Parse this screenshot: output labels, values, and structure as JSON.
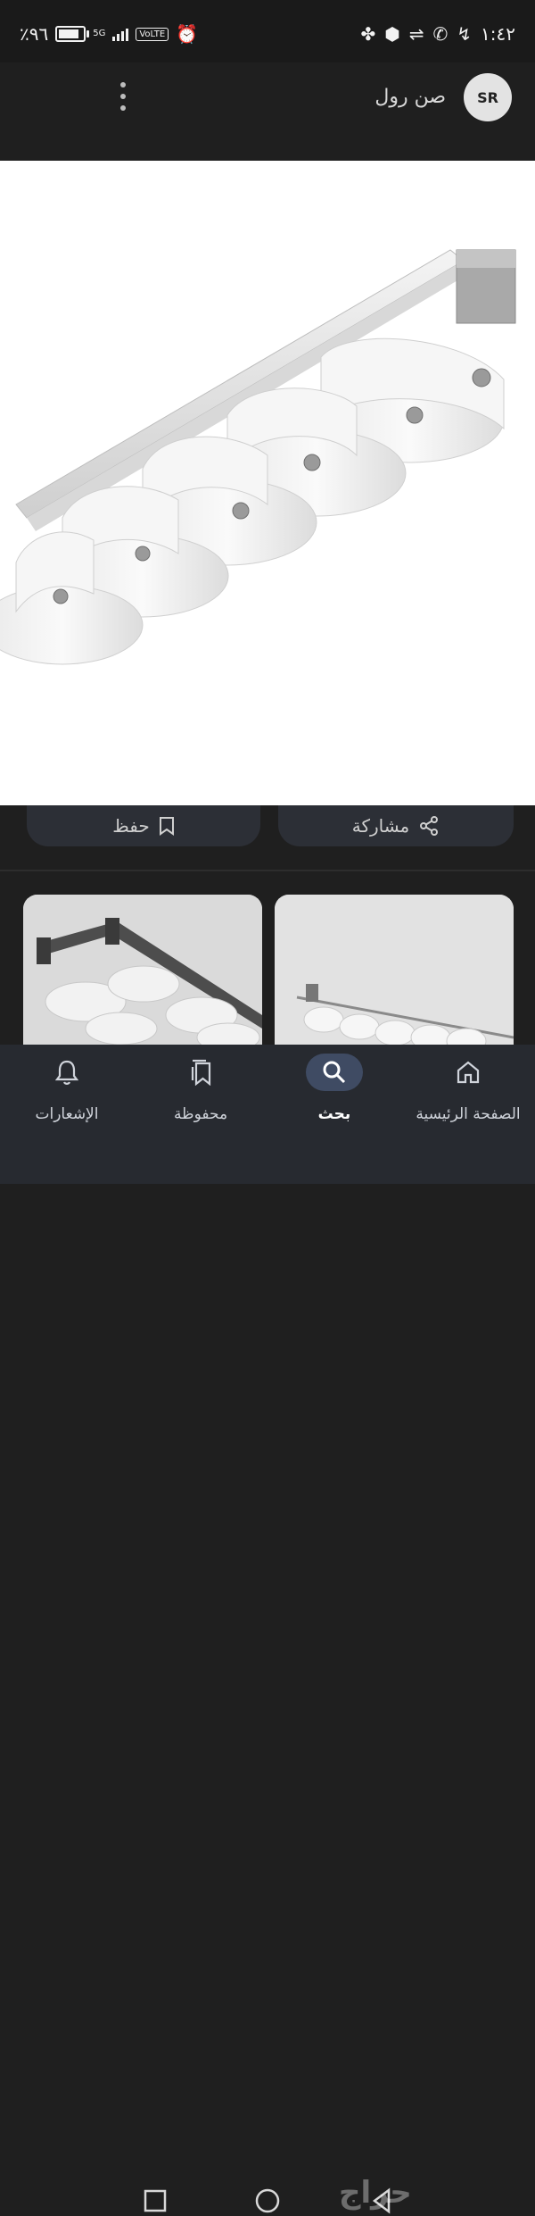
{
  "status_bar": {
    "battery": "٪٩٦",
    "battery_level": 0.96,
    "network": "5G",
    "volte": "VoLTE",
    "time": "١:٤٢"
  },
  "app_bar": {
    "site_name": "صن رول",
    "logo_text": "SR",
    "menu_icon": "more-vert-icon"
  },
  "actions": {
    "save_label": "حفظ",
    "share_label": "مشاركة"
  },
  "bottom_nav": {
    "items": [
      {
        "label": "الإشعارات",
        "icon": "bell-icon"
      },
      {
        "label": "محفوظة",
        "icon": "collections-icon"
      },
      {
        "label": "بحث",
        "icon": "search-icon",
        "active": true
      },
      {
        "label": "الصفحة الرئيسية",
        "icon": "home-icon"
      }
    ]
  },
  "watermark": "حراج",
  "colors": {
    "background": "#1f1f1f",
    "nav_background": "#272a30",
    "active_pill": "#3f4b63",
    "action_pill": "#2c2f36"
  }
}
